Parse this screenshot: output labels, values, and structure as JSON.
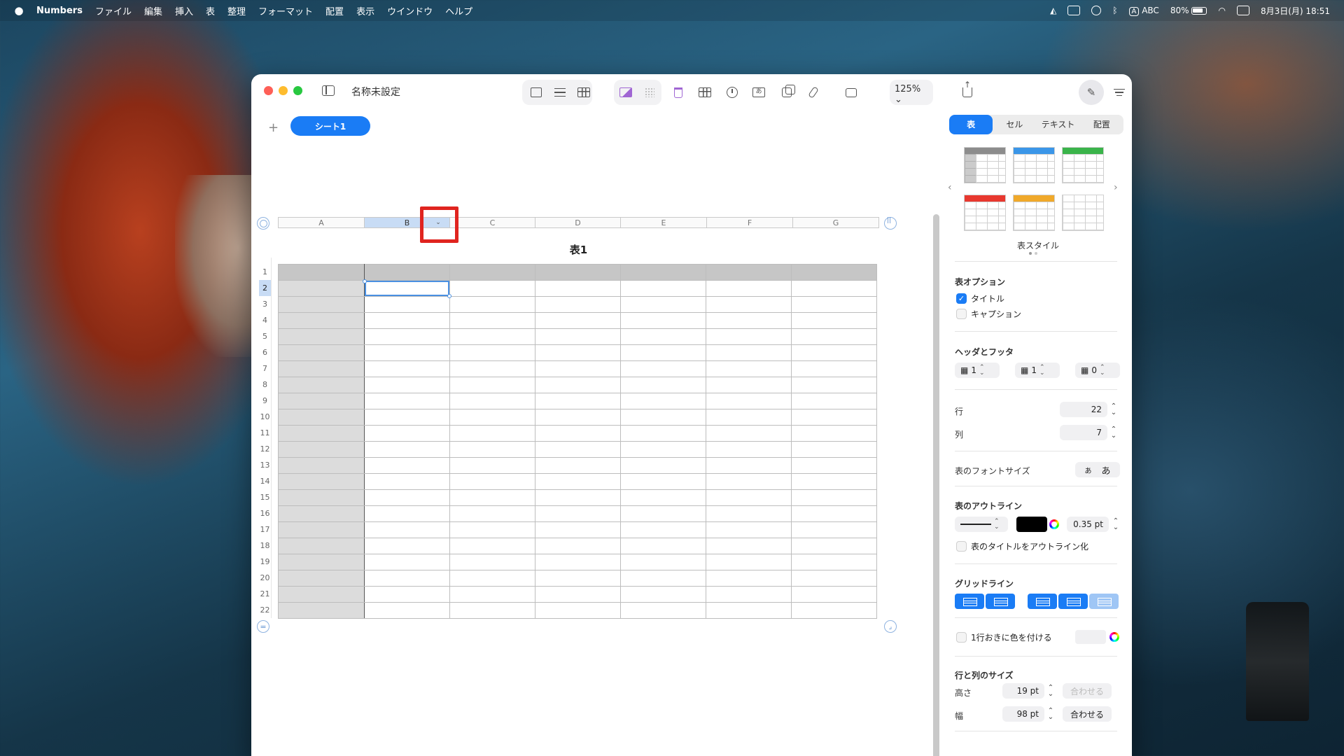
{
  "menubar": {
    "apple": "",
    "app_name": "Numbers",
    "items": [
      "ファイル",
      "編集",
      "挿入",
      "表",
      "整理",
      "フォーマット",
      "配置",
      "表示",
      "ウインドウ",
      "ヘルプ"
    ],
    "input_source": "A",
    "input_label": "ABC",
    "battery": "80%",
    "datetime": "8月3日(月)  18:51"
  },
  "window": {
    "title": "名称未設定",
    "zoom": "125%",
    "sheet_tab": "シート1",
    "table_title": "表1",
    "columns": [
      "A",
      "B",
      "",
      "C",
      "D",
      "E",
      "F",
      "G"
    ],
    "column_labels": [
      "A",
      "B",
      "C",
      "D",
      "E",
      "F",
      "G"
    ],
    "rows": [
      "1",
      "2",
      "3",
      "4",
      "5",
      "6",
      "7",
      "8",
      "9",
      "10",
      "11",
      "12",
      "13",
      "14",
      "15",
      "16",
      "17",
      "18",
      "19",
      "20",
      "21",
      "22"
    ],
    "selected_cell": "B2",
    "col_dropdown_glyph": "⌄"
  },
  "inspector": {
    "tabs": [
      "表",
      "セル",
      "テキスト",
      "配置"
    ],
    "active_tab": "表",
    "table_styles_label": "表スタイル",
    "style_colors": [
      "#8c8c8c",
      "#3b96e8",
      "#3ab44a",
      "#e8382f",
      "#f0a92a",
      "#ffffff"
    ],
    "table_options_title": "表オプション",
    "option_title": "タイトル",
    "option_caption": "キャプション",
    "headers_footers_title": "ヘッダとフッタ",
    "header_rows": "1",
    "header_cols": "1",
    "footer_rows": "0",
    "rows_label": "行",
    "rows_value": "22",
    "cols_label": "列",
    "cols_value": "7",
    "font_size_label": "表のフォントサイズ",
    "font_small": "あ",
    "font_large": "あ",
    "outline_title": "表のアウトライン",
    "outline_width": "0.35 pt",
    "outline_title_option": "表のタイトルをアウトライン化",
    "gridlines_title": "グリッドライン",
    "alternate_rows": "1行おきに色を付ける",
    "row_col_size_title": "行と列のサイズ",
    "height_label": "高さ",
    "height_value": "19 pt",
    "width_label": "幅",
    "width_value": "98 pt",
    "fit_button": "合わせる"
  }
}
